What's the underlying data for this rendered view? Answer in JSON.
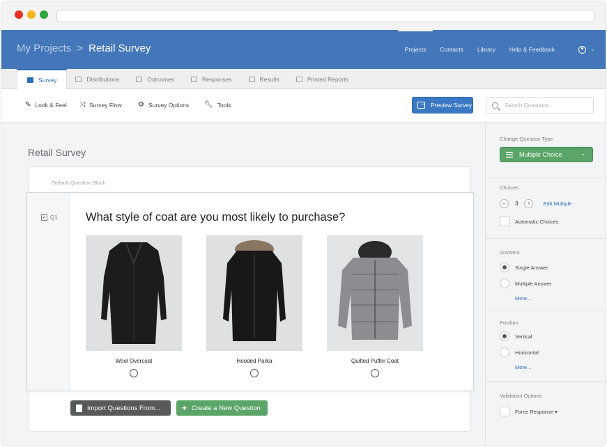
{
  "header": {
    "breadcrumb_root": "My Projects",
    "breadcrumb_sep": ">",
    "breadcrumb_current": "Retail Survey",
    "nav": [
      "Projects",
      "Contacts",
      "Library",
      "Help & Feedback"
    ]
  },
  "tabs": [
    "Survey",
    "Distributions",
    "Outcomes",
    "Responses",
    "Results",
    "Printed Reports"
  ],
  "toolbar": {
    "look_feel": "Look & Feel",
    "survey_flow": "Survey Flow",
    "survey_options": "Survey Options",
    "tools": "Tools",
    "preview": "Preview Survey",
    "search_placeholder": "Search Questions..."
  },
  "main": {
    "survey_title": "Retail Survey",
    "block_label": "Default Question Block",
    "question": {
      "number": "Q1",
      "text": "What style of coat are you most likely to purchase?",
      "choices": [
        "Wool Overcoat",
        "Hooded Parka",
        "Quilted Puffer Coat"
      ]
    },
    "import_button": "Import Questions From...",
    "new_question_button": "Create a New Question"
  },
  "panel": {
    "change_type_label": "Change Question Type",
    "type_value": "Multiple Choice",
    "choices_label": "Choices",
    "choices_count": "3",
    "edit_multiple": "Edit Multiple",
    "automatic_choices": "Automatic Choices",
    "answers_label": "Answers",
    "single_answer": "Single Answer",
    "multiple_answer": "Multiple Answer",
    "answers_more": "More...",
    "position_label": "Position",
    "vertical": "Vertical",
    "horizontal": "Horizontal",
    "position_more": "More...",
    "validation_label": "Validation Options",
    "force_response": "Force Response ▾"
  },
  "colors": {
    "header_blue": "#4477b9",
    "accent_blue": "#2e6db4",
    "green": "#5aa567",
    "dark_button": "#58595b"
  }
}
